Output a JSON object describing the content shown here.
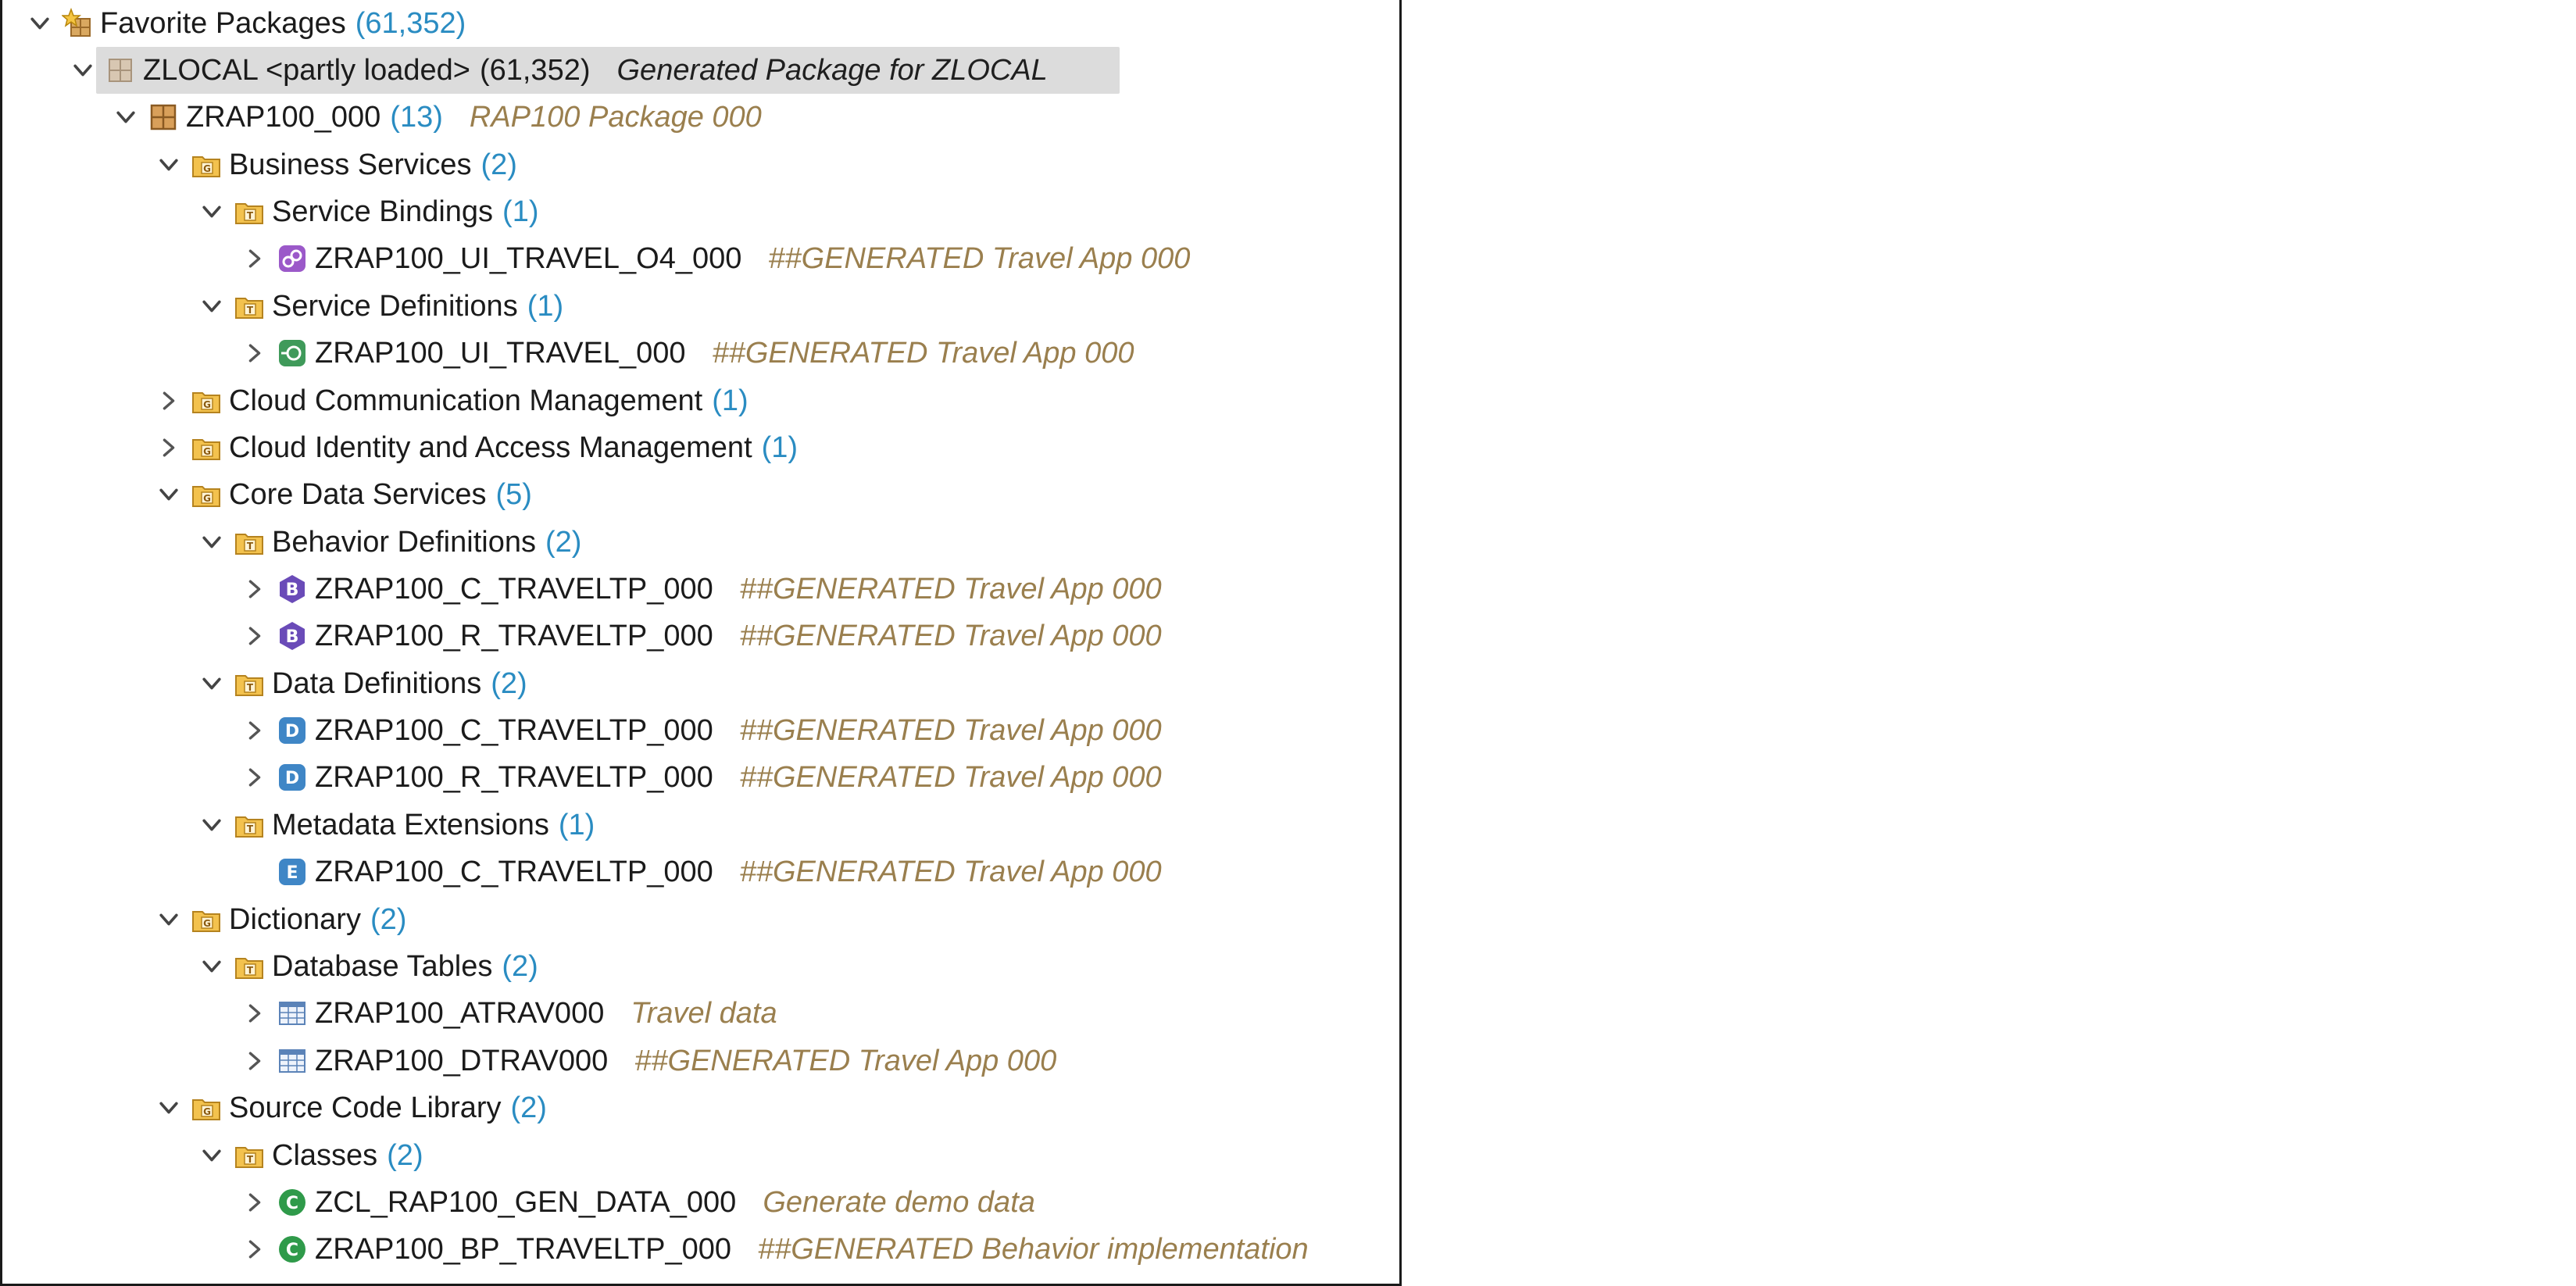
{
  "tree": [
    {
      "name": "Favorite Packages",
      "count": "(61,352)",
      "desc": "",
      "icon": "favorite-packages-icon",
      "chevron": "down"
    },
    {
      "name": "ZLOCAL <partly loaded>",
      "count": "(61,352)",
      "desc": "Generated Package for ZLOCAL",
      "icon": "local-package-icon",
      "chevron": "down",
      "selected": true
    },
    {
      "name": "ZRAP100_000",
      "count": "(13)",
      "desc": "RAP100 Package 000",
      "icon": "package-icon",
      "chevron": "down"
    },
    {
      "name": "Business Services",
      "count": "(2)",
      "desc": "",
      "icon": "group-folder-icon",
      "chevron": "down"
    },
    {
      "name": "Service Bindings",
      "count": "(1)",
      "desc": "",
      "icon": "type-folder-icon",
      "chevron": "down"
    },
    {
      "name": "ZRAP100_UI_TRAVEL_O4_000",
      "count": "",
      "desc": "##GENERATED Travel App 000",
      "icon": "service-binding-icon",
      "chevron": "right"
    },
    {
      "name": "Service Definitions",
      "count": "(1)",
      "desc": "",
      "icon": "type-folder-icon",
      "chevron": "down"
    },
    {
      "name": "ZRAP100_UI_TRAVEL_000",
      "count": "",
      "desc": "##GENERATED Travel App 000",
      "icon": "service-definition-icon",
      "chevron": "right"
    },
    {
      "name": "Cloud Communication Management",
      "count": "(1)",
      "desc": "",
      "icon": "group-folder-icon",
      "chevron": "right"
    },
    {
      "name": "Cloud Identity and Access Management",
      "count": "(1)",
      "desc": "",
      "icon": "group-folder-icon",
      "chevron": "right"
    },
    {
      "name": "Core Data Services",
      "count": "(5)",
      "desc": "",
      "icon": "group-folder-icon",
      "chevron": "down"
    },
    {
      "name": "Behavior Definitions",
      "count": "(2)",
      "desc": "",
      "icon": "type-folder-icon",
      "chevron": "down"
    },
    {
      "name": "ZRAP100_C_TRAVELTP_000",
      "count": "",
      "desc": "##GENERATED Travel App 000",
      "icon": "behavior-definition-icon",
      "chevron": "right"
    },
    {
      "name": "ZRAP100_R_TRAVELTP_000",
      "count": "",
      "desc": "##GENERATED Travel App 000",
      "icon": "behavior-definition-icon",
      "chevron": "right"
    },
    {
      "name": "Data Definitions",
      "count": "(2)",
      "desc": "",
      "icon": "type-folder-icon",
      "chevron": "down"
    },
    {
      "name": "ZRAP100_C_TRAVELTP_000",
      "count": "",
      "desc": "##GENERATED Travel App 000",
      "icon": "data-definition-icon",
      "chevron": "right"
    },
    {
      "name": "ZRAP100_R_TRAVELTP_000",
      "count": "",
      "desc": "##GENERATED Travel App 000",
      "icon": "data-definition-icon",
      "chevron": "right"
    },
    {
      "name": "Metadata Extensions",
      "count": "(1)",
      "desc": "",
      "icon": "type-folder-icon",
      "chevron": "down"
    },
    {
      "name": "ZRAP100_C_TRAVELTP_000",
      "count": "",
      "desc": "##GENERATED Travel App 000",
      "icon": "metadata-extension-icon",
      "chevron": "none"
    },
    {
      "name": "Dictionary",
      "count": "(2)",
      "desc": "",
      "icon": "group-folder-icon",
      "chevron": "down"
    },
    {
      "name": "Database Tables",
      "count": "(2)",
      "desc": "",
      "icon": "type-folder-icon",
      "chevron": "down"
    },
    {
      "name": "ZRAP100_ATRAV000",
      "count": "",
      "desc": "Travel data",
      "icon": "database-table-icon",
      "chevron": "right"
    },
    {
      "name": "ZRAP100_DTRAV000",
      "count": "",
      "desc": "##GENERATED Travel App 000",
      "icon": "database-table-icon",
      "chevron": "right"
    },
    {
      "name": "Source Code Library",
      "count": "(2)",
      "desc": "",
      "icon": "group-folder-icon",
      "chevron": "down"
    },
    {
      "name": "Classes",
      "count": "(2)",
      "desc": "",
      "icon": "type-folder-icon",
      "chevron": "down"
    },
    {
      "name": "ZCL_RAP100_GEN_DATA_000",
      "count": "",
      "desc": "Generate demo data",
      "icon": "class-icon",
      "chevron": "right"
    },
    {
      "name": "ZRAP100_BP_TRAVELTP_000",
      "count": "",
      "desc": "##GENERATED Behavior implementation",
      "icon": "class-icon",
      "chevron": "right"
    }
  ],
  "colors": {
    "count": "#2a8cc2",
    "description": "#9a7f4e",
    "selection": "#dcdcdc"
  }
}
